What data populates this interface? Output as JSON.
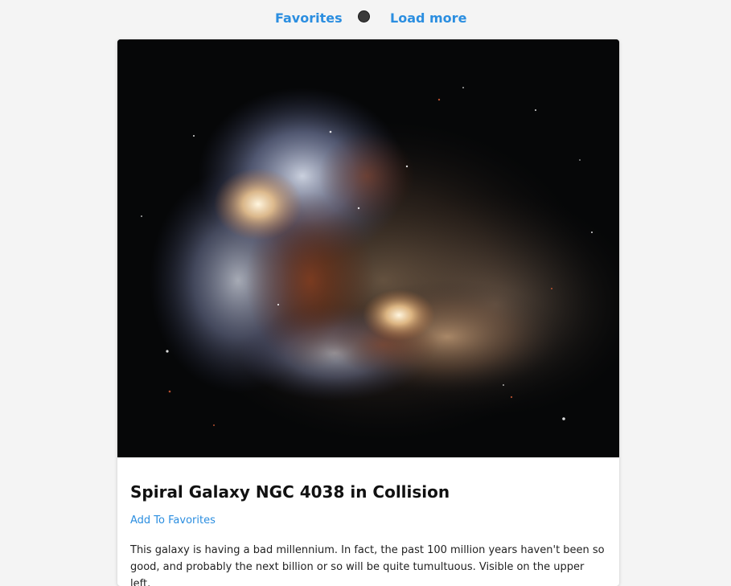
{
  "nav": {
    "favorites_label": "Favorites",
    "load_more_label": "Load more"
  },
  "card": {
    "title": "Spiral Galaxy NGC 4038 in Collision",
    "add_favorites_label": "Add To Favorites",
    "description": "This galaxy is having a bad millennium. In fact, the past 100 million years haven't been so good, and probably the next billion or so will be quite tumultuous. Visible on the upper left,"
  },
  "colors": {
    "link": "#2b8ee0",
    "background": "#f4f4f4",
    "card": "#ffffff"
  }
}
